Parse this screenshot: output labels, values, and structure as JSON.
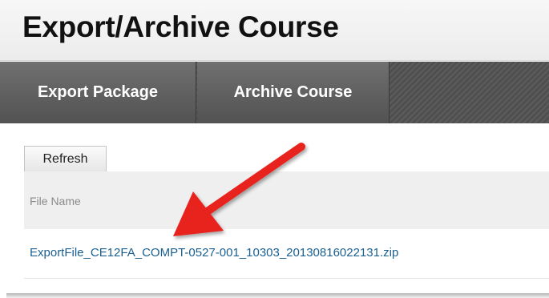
{
  "page": {
    "title": "Export/Archive Course"
  },
  "action_bar": {
    "tabs": [
      {
        "label": "Export Package"
      },
      {
        "label": "Archive Course"
      }
    ]
  },
  "content": {
    "refresh_label": "Refresh",
    "table": {
      "columns": [
        "File Name"
      ],
      "rows": [
        {
          "file_name": "ExportFile_CE12FA_COMPT-0527-001_10303_20130816022131.zip"
        }
      ]
    }
  },
  "annotation": {
    "arrow_icon": "red-arrow-icon",
    "color": "#e8201c"
  },
  "colors": {
    "link": "#1a5f8f",
    "action_bar": "#555555"
  }
}
